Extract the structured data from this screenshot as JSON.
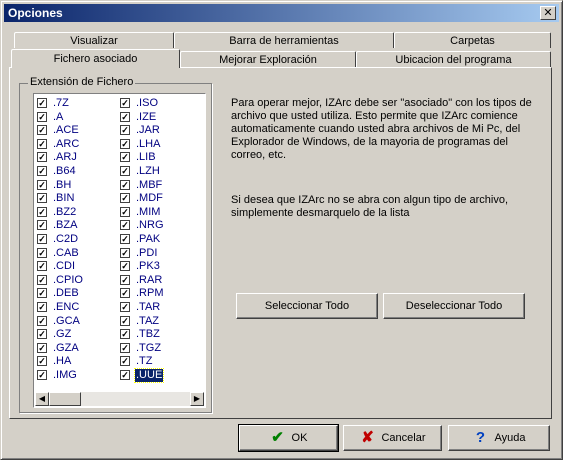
{
  "window": {
    "title": "Opciones",
    "close_glyph": "✕"
  },
  "tabs": {
    "row1": [
      "Visualizar",
      "Barra de herramientas",
      "Carpetas"
    ],
    "row2": [
      "Fichero asociado",
      "Mejorar Exploración",
      "Ubicacion del programa"
    ],
    "active": "Fichero asociado"
  },
  "group": {
    "label": "Extensión de Fichero"
  },
  "extensions": {
    "col1": [
      ".7Z",
      ".A",
      ".ACE",
      ".ARC",
      ".ARJ",
      ".B64",
      ".BH",
      ".BIN",
      ".BZ2",
      ".BZA",
      ".C2D",
      ".CAB",
      ".CDI",
      ".CPIO",
      ".DEB",
      ".ENC",
      ".GCA",
      ".GZ",
      ".GZA",
      ".HA",
      ".IMG"
    ],
    "col2": [
      ".ISO",
      ".IZE",
      ".JAR",
      ".LHA",
      ".LIB",
      ".LZH",
      ".MBF",
      ".MDF",
      ".MIM",
      ".NRG",
      ".PAK",
      ".PDI",
      ".PK3",
      ".RAR",
      ".RPM",
      ".TAR",
      ".TAZ",
      ".TBZ",
      ".TGZ",
      ".TZ",
      ".UUE"
    ],
    "selected": ".UUE",
    "all_checked": true
  },
  "info": {
    "p1": "Para operar mejor, IZArc debe ser \"asociado\" con los tipos de archivo que usted utiliza. Esto permite que IZArc comience automaticamente cuando usted abra archivos de Mi Pc, del Explorador de Windows, de la mayoria de programas del correo, etc.",
    "p2": "Si desea que IZArc no se abra con algun tipo de archivo, simplemente desmarquelo de la lista"
  },
  "buttons": {
    "select_all": "Seleccionar Todo",
    "deselect_all": "Deseleccionar Todo",
    "ok": "OK",
    "cancel": "Cancelar",
    "help": "Ayuda"
  },
  "icons": {
    "ok": "check-icon",
    "cancel": "x-icon",
    "help": "question-icon"
  },
  "colors": {
    "title_start": "#0a246a",
    "title_end": "#a6caf0",
    "list_text": "#000080",
    "ok_icon": "#008000",
    "cancel_icon": "#c00000",
    "help_icon": "#0040c0"
  }
}
